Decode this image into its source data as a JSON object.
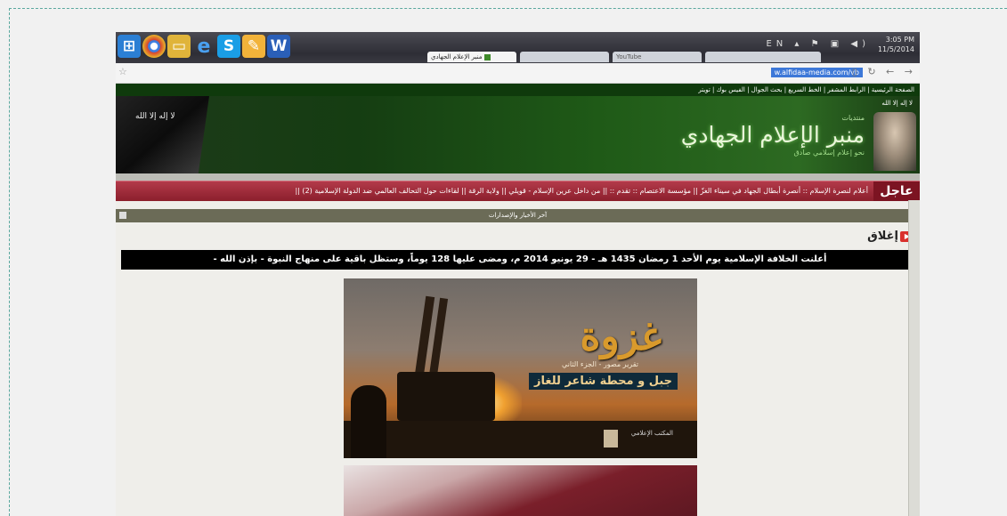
{
  "taskbar": {
    "apps": [
      {
        "icon": "windows-start-icon",
        "color": "#2b7fd4"
      },
      {
        "icon": "chrome-icon",
        "color": "#d8452f"
      },
      {
        "icon": "file-explorer-icon",
        "color": "#e0b43a"
      },
      {
        "icon": "internet-explorer-icon",
        "color": "#1e88d8",
        "glyph": "e"
      },
      {
        "icon": "skype-icon",
        "color": "#1a9ee6",
        "glyph": "S"
      },
      {
        "icon": "paint-icon",
        "color": "#f2b33a"
      },
      {
        "icon": "word-icon",
        "color": "#2a5fb8",
        "glyph": "W"
      }
    ],
    "clock_time": "3:05 PM",
    "clock_date": "11/5/2014",
    "lang": "EN"
  },
  "browser": {
    "tabs": [
      {
        "label": "منبر الإعلام الجهادي",
        "active": true
      },
      {
        "label": "",
        "active": false
      },
      {
        "label": "YouTube",
        "active": false
      },
      {
        "label": "",
        "active": false
      }
    ],
    "url": "w.alfidaa-media.com/vb"
  },
  "site": {
    "top_nav": "الصفحة الرئيسية | الرابط المشفر | الخط السريع | بحث الجوال | الفيس بوك | تويتر",
    "logo_top": "منتديات",
    "logo_name": "منبر الإعلام الجهادي",
    "logo_tagline": "نحو إعلام إسلامي صادق",
    "corner_text": "لا إله إلا الله",
    "flag_text": "لا إله إلا الله",
    "ticker_label": "عاجل",
    "ticker_text": "أعلام لنصرة الإسلام :: أنصرة أبطال الجهاد في سيناء الغزّ || مؤسسة الاعتصام :: تقدم :: || من داخل عرين الإسلام - قويلي || ولاية الرقة || لقاءات حول التحالف العالمي ضد الدولة الإسلامية (2) ||",
    "news_bar": "آخر الأخبار والإصدارات",
    "close_label": "إغلاق",
    "announcement": "أعلنت الخلافة الإسلامية يوم الأحد 1 رمضان 1435 هـ - 29 يونيو 2014 م، ومضى عليها 128 يوماً، وستظل باقية على منهاج النبوة - بإذن الله -"
  },
  "poster": {
    "title": "غزوة",
    "subtitle": "تقرير مصور - الجزء الثاني",
    "headline": "جبل و محطة شاعر للغاز",
    "footer": "المكتب الإعلامي"
  }
}
